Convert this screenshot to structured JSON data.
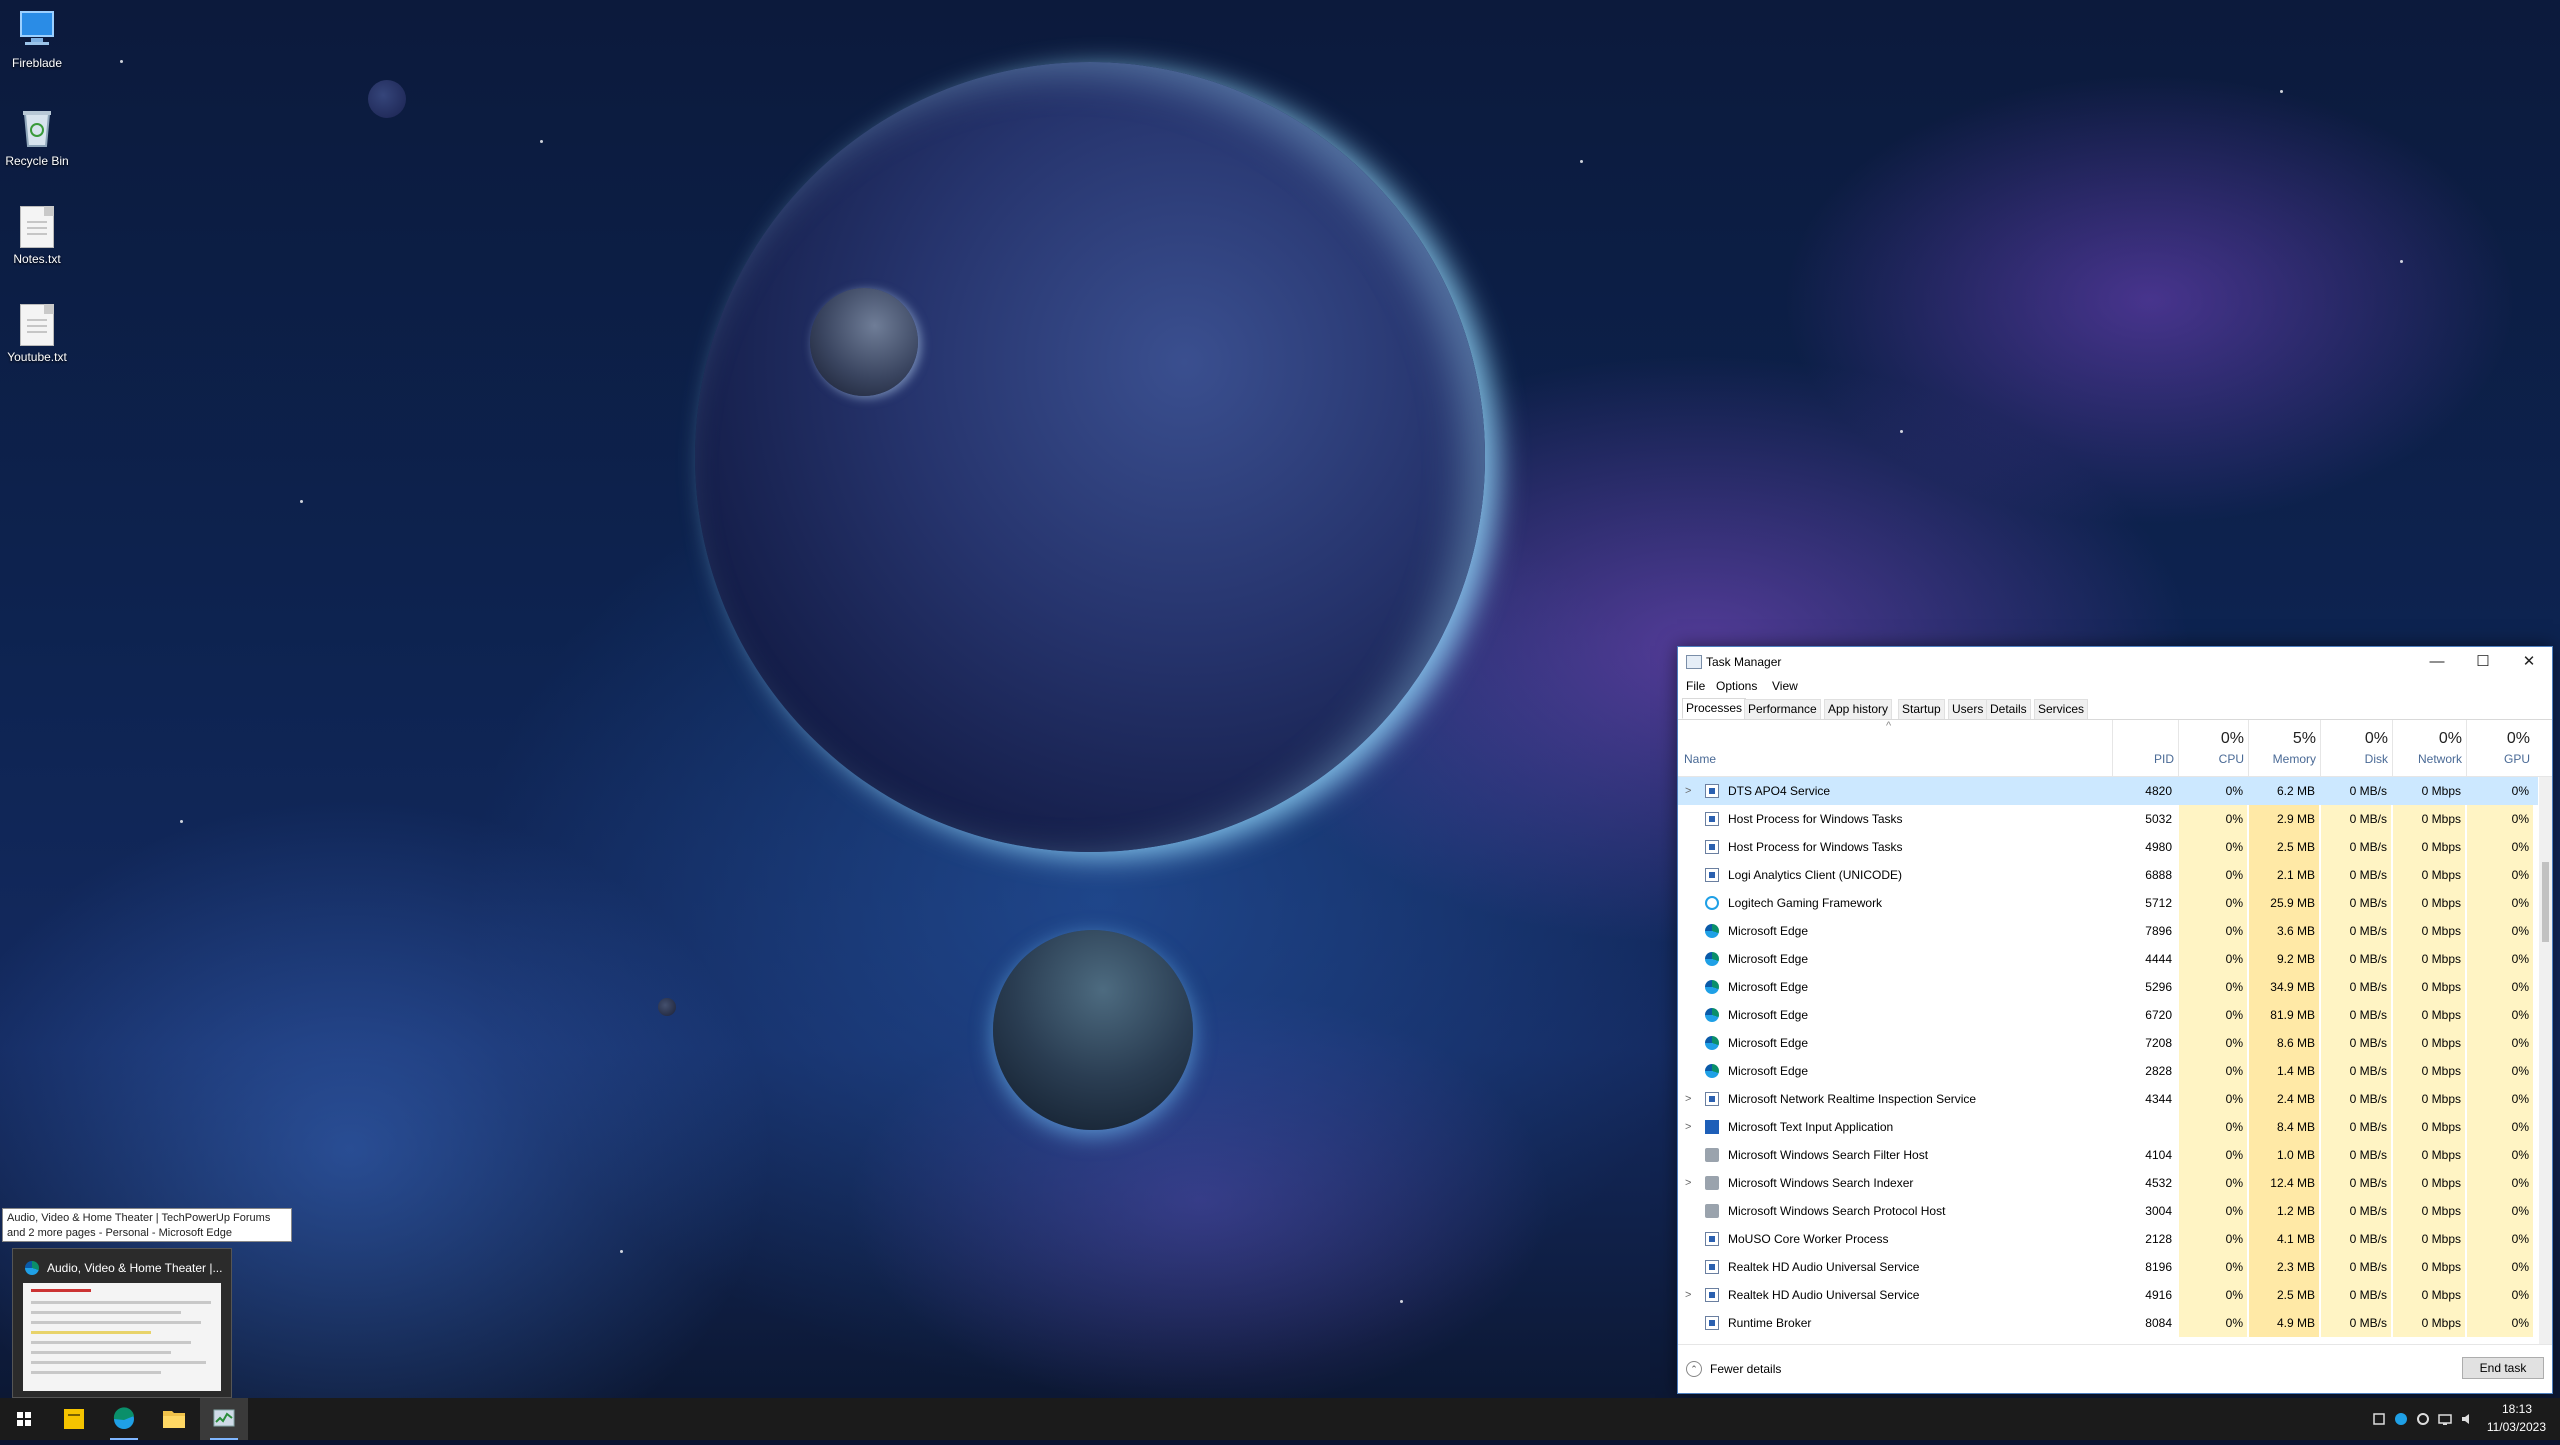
{
  "desktop": {
    "icons": [
      {
        "label": "Fireblade"
      },
      {
        "label": "Recycle Bin"
      },
      {
        "label": "Notes.txt"
      },
      {
        "label": "Youtube.txt"
      }
    ]
  },
  "task_manager": {
    "title": "Task Manager",
    "window_controls": {
      "minimize": "—",
      "maximize": "☐",
      "close": "✕"
    },
    "menu": [
      "File",
      "Options",
      "View"
    ],
    "tabs": [
      "Processes",
      "Performance",
      "App history",
      "Startup",
      "Users",
      "Details",
      "Services"
    ],
    "active_tab": "Processes",
    "columns": {
      "name": "Name",
      "pid": "PID",
      "cpu": {
        "pct": "0%",
        "label": "CPU"
      },
      "memory": {
        "pct": "5%",
        "label": "Memory"
      },
      "disk": {
        "pct": "0%",
        "label": "Disk"
      },
      "network": {
        "pct": "0%",
        "label": "Network"
      },
      "gpu": {
        "pct": "0%",
        "label": "GPU"
      }
    },
    "sort_indicator": "^",
    "rows": [
      {
        "name": "DTS APO4 Service",
        "pid": "4820",
        "cpu": "0%",
        "mem": "6.2 MB",
        "disk": "0 MB/s",
        "net": "0 Mbps",
        "gpu": "0%",
        "icon": "box",
        "expand": true,
        "selected": true
      },
      {
        "name": "Host Process for Windows Tasks",
        "pid": "5032",
        "cpu": "0%",
        "mem": "2.9 MB",
        "disk": "0 MB/s",
        "net": "0 Mbps",
        "gpu": "0%",
        "icon": "box",
        "expand": false
      },
      {
        "name": "Host Process for Windows Tasks",
        "pid": "4980",
        "cpu": "0%",
        "mem": "2.5 MB",
        "disk": "0 MB/s",
        "net": "0 Mbps",
        "gpu": "0%",
        "icon": "box",
        "expand": false
      },
      {
        "name": "Logi Analytics Client (UNICODE)",
        "pid": "6888",
        "cpu": "0%",
        "mem": "2.1 MB",
        "disk": "0 MB/s",
        "net": "0 Mbps",
        "gpu": "0%",
        "icon": "box",
        "expand": false
      },
      {
        "name": "Logitech Gaming Framework",
        "pid": "5712",
        "cpu": "0%",
        "mem": "25.9 MB",
        "disk": "0 MB/s",
        "net": "0 Mbps",
        "gpu": "0%",
        "icon": "logi",
        "expand": false
      },
      {
        "name": "Microsoft Edge",
        "pid": "7896",
        "cpu": "0%",
        "mem": "3.6 MB",
        "disk": "0 MB/s",
        "net": "0 Mbps",
        "gpu": "0%",
        "icon": "edge",
        "expand": false
      },
      {
        "name": "Microsoft Edge",
        "pid": "4444",
        "cpu": "0%",
        "mem": "9.2 MB",
        "disk": "0 MB/s",
        "net": "0 Mbps",
        "gpu": "0%",
        "icon": "edge",
        "expand": false
      },
      {
        "name": "Microsoft Edge",
        "pid": "5296",
        "cpu": "0%",
        "mem": "34.9 MB",
        "disk": "0 MB/s",
        "net": "0 Mbps",
        "gpu": "0%",
        "icon": "edge",
        "expand": false
      },
      {
        "name": "Microsoft Edge",
        "pid": "6720",
        "cpu": "0%",
        "mem": "81.9 MB",
        "disk": "0 MB/s",
        "net": "0 Mbps",
        "gpu": "0%",
        "icon": "edge",
        "expand": false
      },
      {
        "name": "Microsoft Edge",
        "pid": "7208",
        "cpu": "0%",
        "mem": "8.6 MB",
        "disk": "0 MB/s",
        "net": "0 Mbps",
        "gpu": "0%",
        "icon": "edge",
        "expand": false
      },
      {
        "name": "Microsoft Edge",
        "pid": "2828",
        "cpu": "0%",
        "mem": "1.4 MB",
        "disk": "0 MB/s",
        "net": "0 Mbps",
        "gpu": "0%",
        "icon": "edge",
        "expand": false
      },
      {
        "name": "Microsoft Network Realtime Inspection Service",
        "pid": "4344",
        "cpu": "0%",
        "mem": "2.4 MB",
        "disk": "0 MB/s",
        "net": "0 Mbps",
        "gpu": "0%",
        "icon": "box",
        "expand": true
      },
      {
        "name": "Microsoft Text Input Application",
        "pid": "",
        "cpu": "0%",
        "mem": "8.4 MB",
        "disk": "0 MB/s",
        "net": "0 Mbps",
        "gpu": "0%",
        "icon": "text",
        "expand": true
      },
      {
        "name": "Microsoft Windows Search Filter Host",
        "pid": "4104",
        "cpu": "0%",
        "mem": "1.0 MB",
        "disk": "0 MB/s",
        "net": "0 Mbps",
        "gpu": "0%",
        "icon": "search",
        "expand": false
      },
      {
        "name": "Microsoft Windows Search Indexer",
        "pid": "4532",
        "cpu": "0%",
        "mem": "12.4 MB",
        "disk": "0 MB/s",
        "net": "0 Mbps",
        "gpu": "0%",
        "icon": "search",
        "expand": true
      },
      {
        "name": "Microsoft Windows Search Protocol Host",
        "pid": "3004",
        "cpu": "0%",
        "mem": "1.2 MB",
        "disk": "0 MB/s",
        "net": "0 Mbps",
        "gpu": "0%",
        "icon": "search",
        "expand": false
      },
      {
        "name": "MoUSO Core Worker Process",
        "pid": "2128",
        "cpu": "0%",
        "mem": "4.1 MB",
        "disk": "0 MB/s",
        "net": "0 Mbps",
        "gpu": "0%",
        "icon": "box",
        "expand": false
      },
      {
        "name": "Realtek HD Audio Universal Service",
        "pid": "8196",
        "cpu": "0%",
        "mem": "2.3 MB",
        "disk": "0 MB/s",
        "net": "0 Mbps",
        "gpu": "0%",
        "icon": "box",
        "expand": false
      },
      {
        "name": "Realtek HD Audio Universal Service",
        "pid": "4916",
        "cpu": "0%",
        "mem": "2.5 MB",
        "disk": "0 MB/s",
        "net": "0 Mbps",
        "gpu": "0%",
        "icon": "box",
        "expand": true
      },
      {
        "name": "Runtime Broker",
        "pid": "8084",
        "cpu": "0%",
        "mem": "4.9 MB",
        "disk": "0 MB/s",
        "net": "0 Mbps",
        "gpu": "0%",
        "icon": "box",
        "expand": false
      }
    ],
    "footer": {
      "fewer_details": "Fewer details",
      "end_task": "End task"
    }
  },
  "tooltip": {
    "line1": "Audio, Video & Home Theater | TechPowerUp Forums",
    "line2": "and 2 more pages - Personal - Microsoft Edge"
  },
  "preview": {
    "title": "Audio, Video & Home Theater |..."
  },
  "clock": {
    "time": "18:13",
    "date": "11/03/2023"
  },
  "colors": {
    "selected_row": "#cce8ff",
    "heat_light": "#fff4c4",
    "heat_medium": "#ffe9a6",
    "taskbar": "#1b1b1b",
    "accent": "#4d7fbf"
  }
}
